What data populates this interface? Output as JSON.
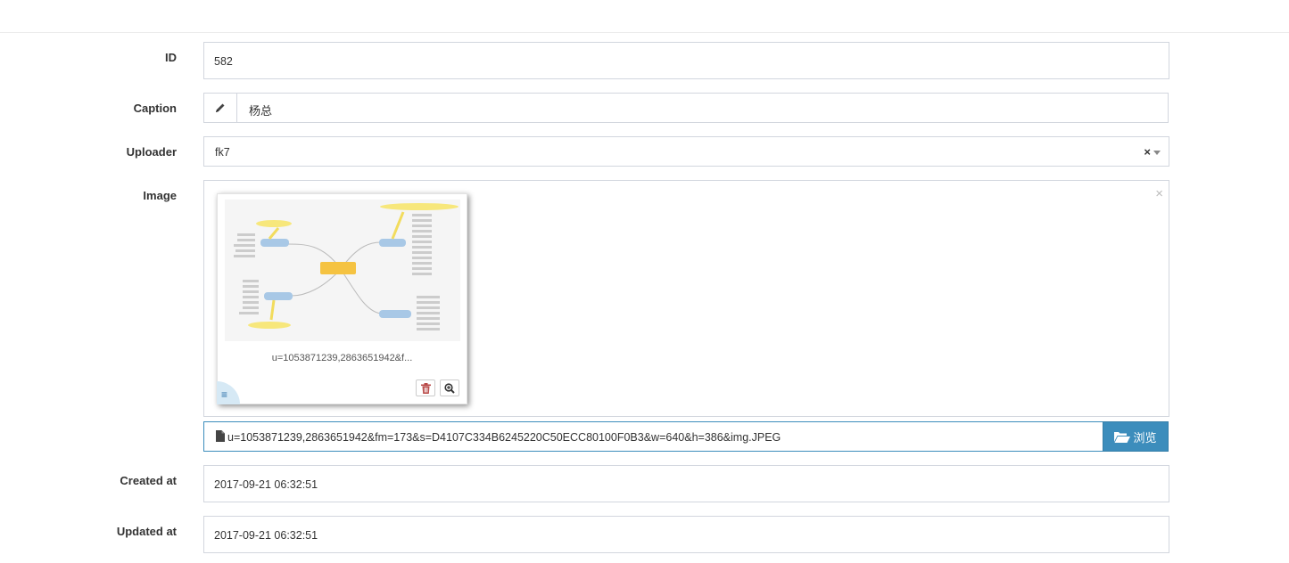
{
  "form": {
    "id": {
      "label": "ID",
      "value": "582"
    },
    "caption": {
      "label": "Caption",
      "value": "杨总",
      "icon": "pencil-icon"
    },
    "uploader": {
      "label": "Uploader",
      "value": "fk7",
      "clear_symbol": "×"
    },
    "image": {
      "label": "Image",
      "close_symbol": "×",
      "thumbnail_caption": "u=1053871239,2863651942&f...",
      "drag_symbol": "≡",
      "file_caption": "u=1053871239,2863651942&fm=173&s=D4107C334B6245220C50ECC80100F0B3&w=640&h=386&img.JPEG",
      "browse_label": "浏览",
      "accent_color": "#3c8dbc"
    },
    "created_at": {
      "label": "Created at",
      "value": "2017-09-21 06:32:51"
    },
    "updated_at": {
      "label": "Updated at",
      "value": "2017-09-21 06:32:51"
    }
  }
}
